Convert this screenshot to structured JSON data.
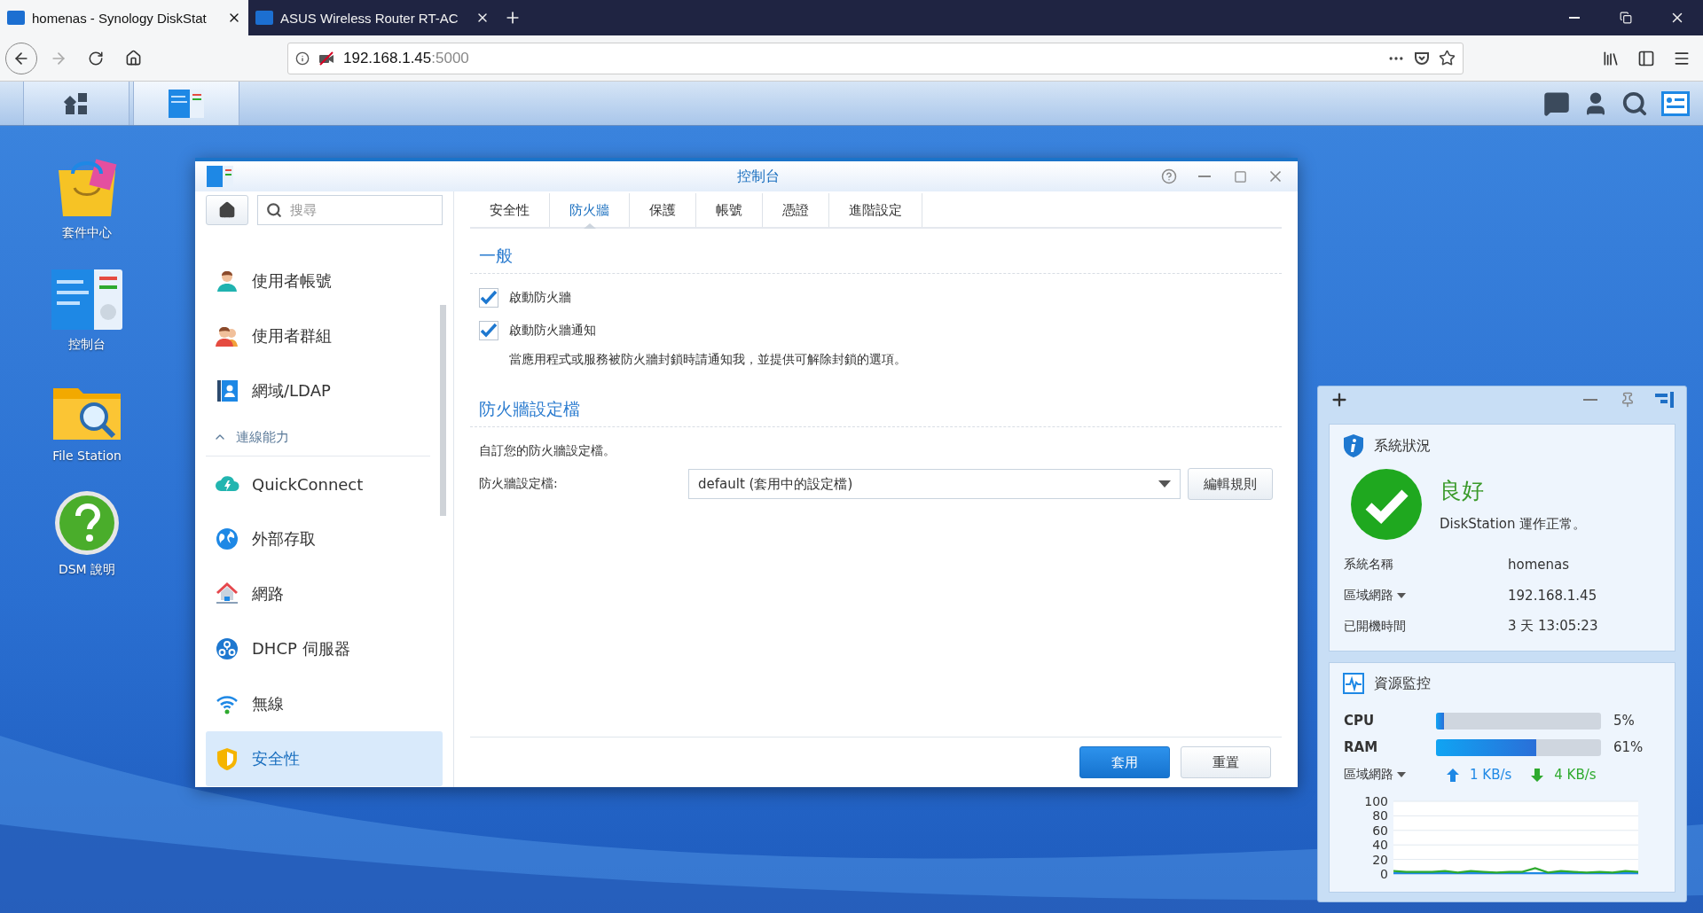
{
  "browser": {
    "tabs": [
      {
        "title": "homenas - Synology DiskStat",
        "selected": true
      },
      {
        "title": "ASUS Wireless Router RT-AC",
        "selected": false
      }
    ],
    "address": {
      "host": "192.168.1.45",
      "port": ":5000"
    }
  },
  "desktop_icons": [
    {
      "label": "套件中心"
    },
    {
      "label": "控制台"
    },
    {
      "label": "File Station"
    },
    {
      "label": "DSM 說明"
    }
  ],
  "control_panel": {
    "title": "控制台",
    "search": {
      "placeholder": "搜尋"
    },
    "sidebar": {
      "items": [
        {
          "kind": "item",
          "label": "使用者帳號",
          "selected": false
        },
        {
          "kind": "item",
          "label": "使用者群組",
          "selected": false
        },
        {
          "kind": "item",
          "label": "網域/LDAP",
          "selected": false
        },
        {
          "kind": "section",
          "label": "連線能力",
          "expanded": true
        },
        {
          "kind": "item",
          "label": "QuickConnect",
          "selected": false
        },
        {
          "kind": "item",
          "label": "外部存取",
          "selected": false
        },
        {
          "kind": "item",
          "label": "網路",
          "selected": false
        },
        {
          "kind": "item",
          "label": "DHCP 伺服器",
          "selected": false
        },
        {
          "kind": "item",
          "label": "無線",
          "selected": false
        },
        {
          "kind": "item",
          "label": "安全性",
          "selected": true
        }
      ]
    },
    "tabs": [
      {
        "label": "安全性",
        "selected": false
      },
      {
        "label": "防火牆",
        "selected": true
      },
      {
        "label": "保護",
        "selected": false
      },
      {
        "label": "帳號",
        "selected": false
      },
      {
        "label": "憑證",
        "selected": false
      },
      {
        "label": "進階設定",
        "selected": false
      }
    ],
    "general": {
      "title": "一般",
      "options": [
        {
          "label": "啟動防火牆",
          "checked": true
        },
        {
          "label": "啟動防火牆通知",
          "checked": true
        }
      ],
      "description": "當應用程式或服務被防火牆封鎖時請通知我，並提供可解除封鎖的選項。"
    },
    "profile": {
      "title": "防火牆設定檔",
      "description": "自訂您的防火牆設定檔。",
      "field_label": "防火牆設定檔:",
      "value": "default (套用中的設定檔)",
      "edit_button": "編輯規則"
    },
    "buttons": [
      {
        "label": "套用",
        "kind": "primary"
      },
      {
        "label": "重置",
        "kind": "secondary"
      }
    ]
  },
  "widget": {
    "system_status": {
      "title": "系統狀況",
      "status": "良好",
      "message": "DiskStation 運作正常。",
      "rows": [
        {
          "label": "系統名稱",
          "value": "homenas",
          "dropdown": false
        },
        {
          "label": "區域網路",
          "value": "192.168.1.45",
          "dropdown": true
        },
        {
          "label": "已開機時間",
          "value": "3 天 13:05:23",
          "dropdown": false
        }
      ]
    },
    "resource_monitor": {
      "title": "資源監控",
      "meters": [
        {
          "label": "CPU",
          "level": 0.05,
          "reading": "5%"
        },
        {
          "label": "RAM",
          "level": 0.61,
          "reading": "61%"
        }
      ],
      "network": {
        "label": "區域網路",
        "upload": "1 KB/s",
        "download": "4 KB/s"
      },
      "chart_data": {
        "type": "line",
        "grid": true,
        "ylim": [
          0,
          100
        ],
        "yticks": [
          0,
          20,
          40,
          60,
          80,
          100
        ],
        "series": [
          {
            "color": "#1e88e5",
            "values": [
              1,
              1,
              1,
              1,
              1,
              1,
              1,
              1,
              1,
              1,
              1,
              1,
              1,
              1,
              1,
              1,
              1,
              1,
              1,
              1
            ]
          },
          {
            "color": "#2eaa2e",
            "values": [
              4,
              3,
              3,
              3,
              4,
              2,
              4,
              3,
              2,
              3,
              3,
              8,
              2,
              4,
              3,
              2,
              3,
              2,
              4,
              3
            ]
          }
        ]
      }
    }
  }
}
